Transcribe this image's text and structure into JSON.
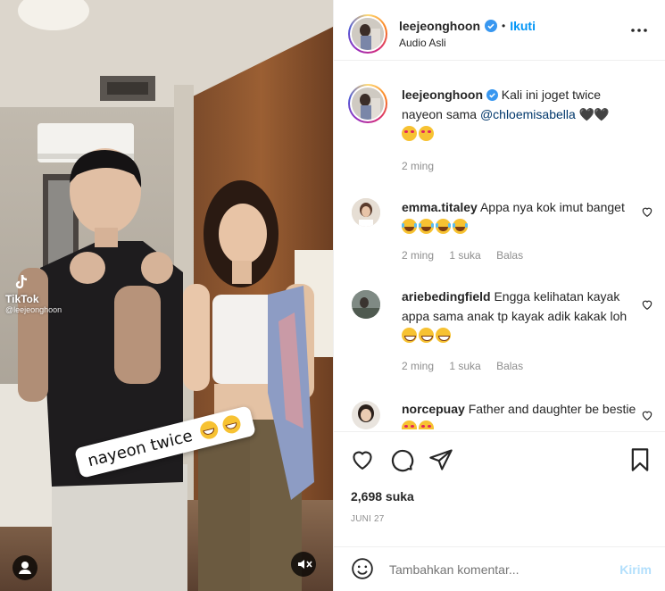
{
  "post": {
    "username": "leejeonghoon",
    "follow_sep": "•",
    "follow_label": "Ikuti",
    "audio_label": "Audio Asli",
    "more_label": "•••"
  },
  "caption": {
    "username": "leejeonghoon",
    "text": "Kali ini joget twice nayeon sama",
    "mention": "@chloemisabella",
    "hearts": "🖤🖤",
    "time": "2 ming"
  },
  "comments": [
    {
      "username": "emma.titaley",
      "text": "Appa nya kok imut banget",
      "time": "2 ming",
      "likes": "1 suka",
      "reply": "Balas"
    },
    {
      "username": "ariebedingfield",
      "text": "Engga kelihatan kayak appa sama anak tp kayak adik kakak loh",
      "time": "2 ming",
      "likes": "1 suka",
      "reply": "Balas"
    },
    {
      "username": "norcepuay",
      "text": "Father and daughter be bestie",
      "time": "",
      "likes": "",
      "reply": ""
    }
  ],
  "stats": {
    "likes": "2,698 suka",
    "date": "JUNI 27"
  },
  "add_comment": {
    "placeholder": "Tambahkan komentar...",
    "submit": "Kirim"
  },
  "video": {
    "overlay_text": "nayeon twice",
    "watermark_brand": "TikTok",
    "watermark_handle": "@leejeonghoon"
  },
  "icons": {
    "verified": "verified-badge-icon",
    "more": "more-options-icon",
    "like": "heart-icon",
    "comment": "comment-icon",
    "share": "paper-plane-icon",
    "save": "bookmark-icon",
    "emoji": "smiley-icon",
    "user": "user-tag-icon",
    "mute": "speaker-muted-icon"
  },
  "colors": {
    "link": "#00376b",
    "verified": "#3897f0",
    "follow": "#0095f6",
    "submit_disabled": "#b2dffc"
  }
}
